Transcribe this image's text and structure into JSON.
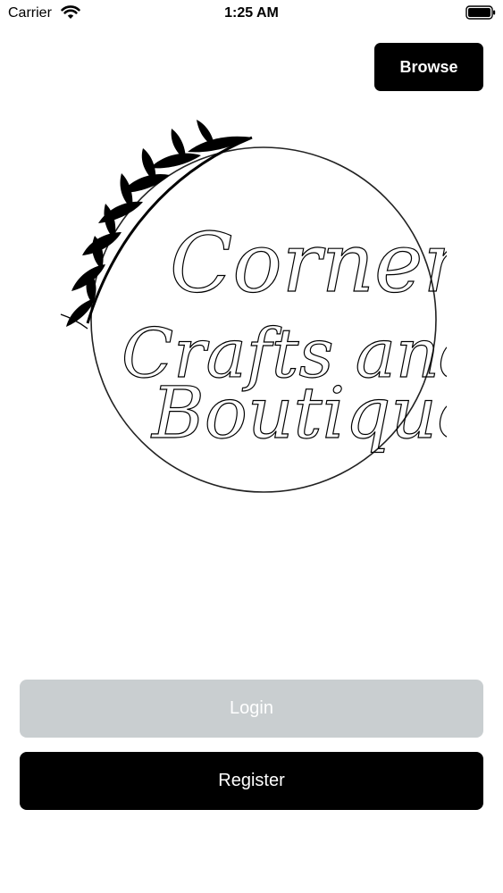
{
  "status_bar": {
    "carrier": "Carrier",
    "time": "1:25 AM",
    "wifi_icon": "wifi-icon",
    "battery_icon": "battery-icon"
  },
  "header": {
    "browse_label": "Browse"
  },
  "logo": {
    "line1": "Corner",
    "line2": "Crafts and",
    "line3": "Boutique",
    "decoration_icon": "leaf-branch-icon"
  },
  "actions": {
    "login_label": "Login",
    "register_label": "Register"
  },
  "colors": {
    "primary": "#000000",
    "disabled": "#c9ced0",
    "background": "#ffffff"
  }
}
